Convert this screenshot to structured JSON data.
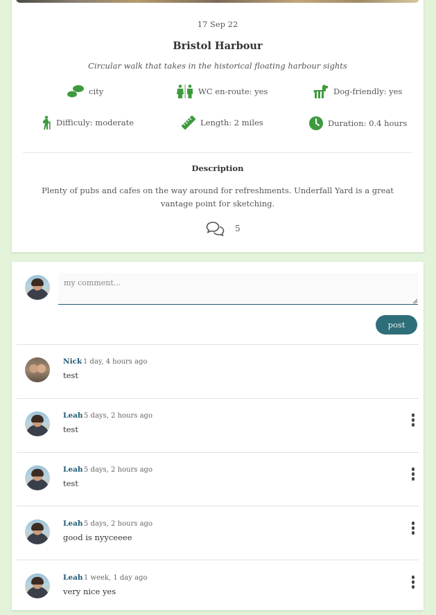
{
  "walk": {
    "date": "17 Sep 22",
    "title": "Bristol Harbour",
    "subtitle": "Circular walk that takes in the historical floating harbour sights",
    "features": {
      "terrain": "city",
      "wc": "WC en-route: yes",
      "dog": "Dog-friendly: yes",
      "difficulty": "Difficuly: moderate",
      "length": "Length: 2 miles",
      "duration": "Duration: 0.4 hours"
    },
    "description_heading": "Description",
    "description": "Plenty of pubs and cafes on the way around for refreshments. Underfall Yard is a great vantage point for sketching.",
    "comment_count": "5"
  },
  "comment_form": {
    "placeholder": "my comment...",
    "post_label": "post"
  },
  "comments": [
    {
      "author": "Nick",
      "time": "1 day, 4 hours ago",
      "text": "test"
    },
    {
      "author": "Leah",
      "time": "5 days, 2 hours ago",
      "text": "test"
    },
    {
      "author": "Leah",
      "time": "5 days, 2 hours ago",
      "text": "test"
    },
    {
      "author": "Leah",
      "time": "5 days, 2 hours ago",
      "text": "good is nyyceeee"
    },
    {
      "author": "Leah",
      "time": "1 week, 1 day ago",
      "text": "very nice yes"
    }
  ],
  "icons": {
    "feature_icon_color": "#3e9a3e",
    "comment_icon_color": "#555555",
    "accent": "#1f5a75",
    "post_button_color": "#2e6e78",
    "background": "#e3f3d9"
  }
}
